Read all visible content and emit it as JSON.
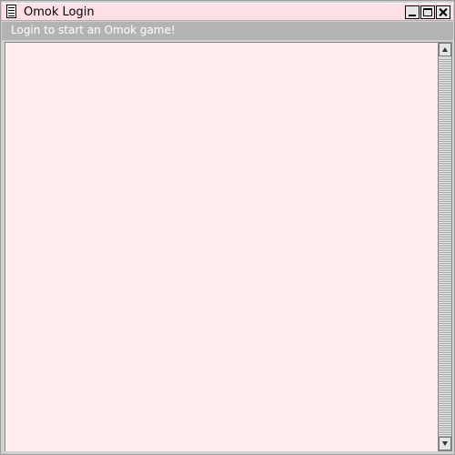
{
  "window": {
    "title": "Omok Login",
    "icon": "document-icon"
  },
  "title_buttons": {
    "minimize": "minimize-icon",
    "maximize": "maximize-icon",
    "close": "close-icon"
  },
  "subtitle": {
    "text": "Login to start an Omok game!"
  },
  "colors": {
    "titlebar_bg": "#ffdfe6",
    "subtitle_bg": "#b3b3b3",
    "content_bg": "#ffecef",
    "subtitle_text": "#ffffff"
  },
  "scrollbar": {
    "up_icon": "scroll-up-arrow-icon",
    "down_icon": "scroll-down-arrow-icon"
  }
}
